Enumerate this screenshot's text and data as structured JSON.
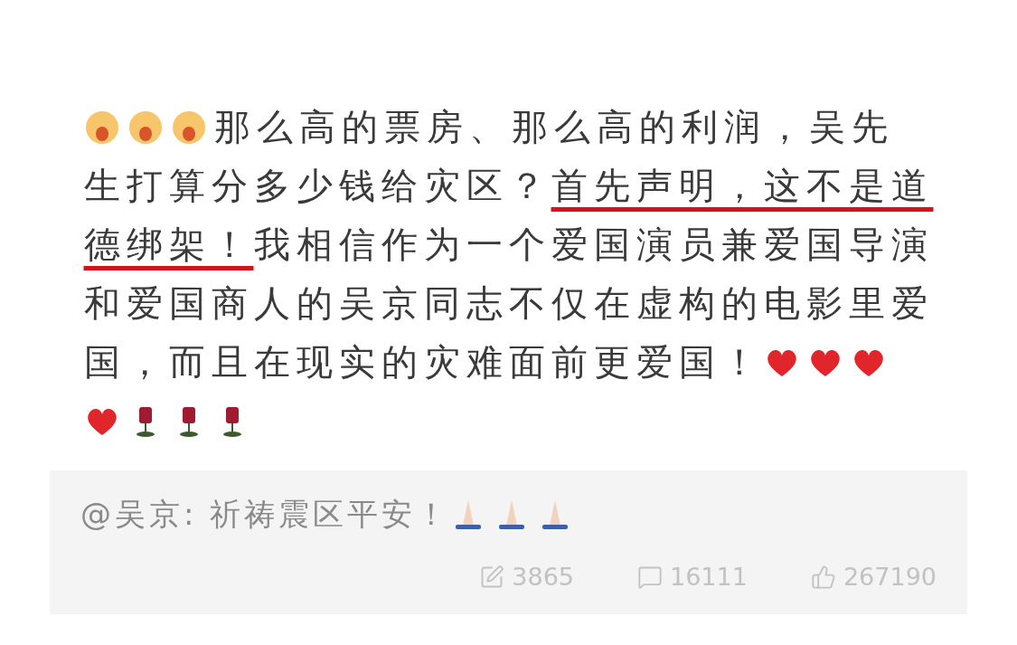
{
  "post": {
    "lines": [
      {
        "items": [
          {
            "kind": "surprised-emoji"
          },
          {
            "kind": "surprised-emoji"
          },
          {
            "kind": "surprised-emoji"
          },
          {
            "kind": "text",
            "text": "那么高的票房、那么高的利润，吴先",
            "underlined": false
          }
        ]
      },
      {
        "items": [
          {
            "kind": "text",
            "text": "生打算分多少钱给灾区？",
            "underlined": false
          },
          {
            "kind": "text",
            "text": "首先声明，这不是道",
            "underlined": true
          }
        ]
      },
      {
        "items": [
          {
            "kind": "text",
            "text": "德绑架！",
            "underlined": true
          },
          {
            "kind": "text",
            "text": "我相信作为一个爱国演员兼爱国导演",
            "underlined": false
          }
        ]
      },
      {
        "items": [
          {
            "kind": "text",
            "text": "和爱国商人的吴京同志不仅在虚构的电影里爱",
            "underlined": false
          }
        ]
      },
      {
        "items": [
          {
            "kind": "text",
            "text": "国，而且在现实的灾难面前更爱国！",
            "underlined": false
          },
          {
            "kind": "heart"
          },
          {
            "kind": "heart"
          },
          {
            "kind": "heart"
          }
        ]
      },
      {
        "items": [
          {
            "kind": "heart"
          },
          {
            "kind": "rose"
          },
          {
            "kind": "rose"
          },
          {
            "kind": "rose"
          }
        ]
      }
    ]
  },
  "quoted": {
    "author": "@吴京:",
    "text": "祈祷震区平安！",
    "icons": [
      {
        "kind": "praying-hands"
      },
      {
        "kind": "praying-hands"
      },
      {
        "kind": "praying-hands"
      }
    ],
    "stats": [
      {
        "kind": "repost",
        "count": "3865"
      },
      {
        "kind": "comment",
        "count": "16111"
      },
      {
        "kind": "like",
        "count": "267190"
      }
    ]
  }
}
